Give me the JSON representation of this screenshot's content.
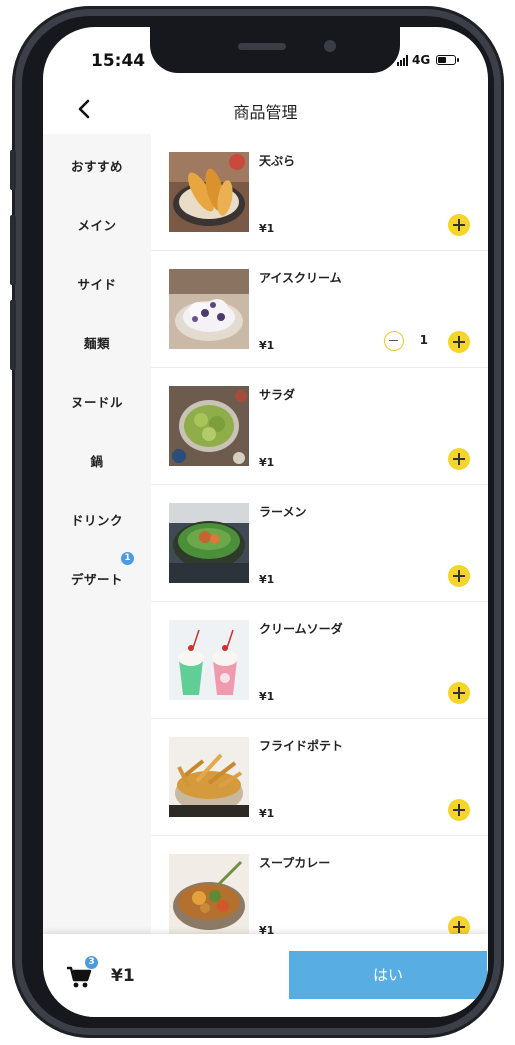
{
  "status": {
    "time": "15:44",
    "network": "4G"
  },
  "header": {
    "title": "商品管理"
  },
  "sidebar": {
    "items": [
      {
        "label": "おすすめ"
      },
      {
        "label": "メイン"
      },
      {
        "label": "サイド"
      },
      {
        "label": "麺類"
      },
      {
        "label": "ヌードル"
      },
      {
        "label": "鍋"
      },
      {
        "label": "ドリンク"
      },
      {
        "label": "デザート",
        "badge": "1"
      }
    ]
  },
  "products": [
    {
      "name": "天ぷら",
      "price": "¥1",
      "image": "tempura-image"
    },
    {
      "name": "アイスクリーム",
      "price": "¥1",
      "image": "icecream-image",
      "quantity": "1"
    },
    {
      "name": "サラダ",
      "price": "¥1",
      "image": "salad-image"
    },
    {
      "name": "ラーメン",
      "price": "¥1",
      "image": "ramen-image"
    },
    {
      "name": "クリームソーダ",
      "price": "¥1",
      "image": "creamsoda-image"
    },
    {
      "name": "フライドポテト",
      "price": "¥1",
      "image": "fries-image"
    },
    {
      "name": "スープカレー",
      "price": "¥1",
      "image": "soupcurry-image"
    }
  ],
  "cart": {
    "count": "3",
    "total": "¥1",
    "confirm_label": "はい"
  },
  "colors": {
    "accent_yellow": "#f5d52a",
    "button_blue": "#58aee3",
    "badge_blue": "#4a9be0"
  }
}
